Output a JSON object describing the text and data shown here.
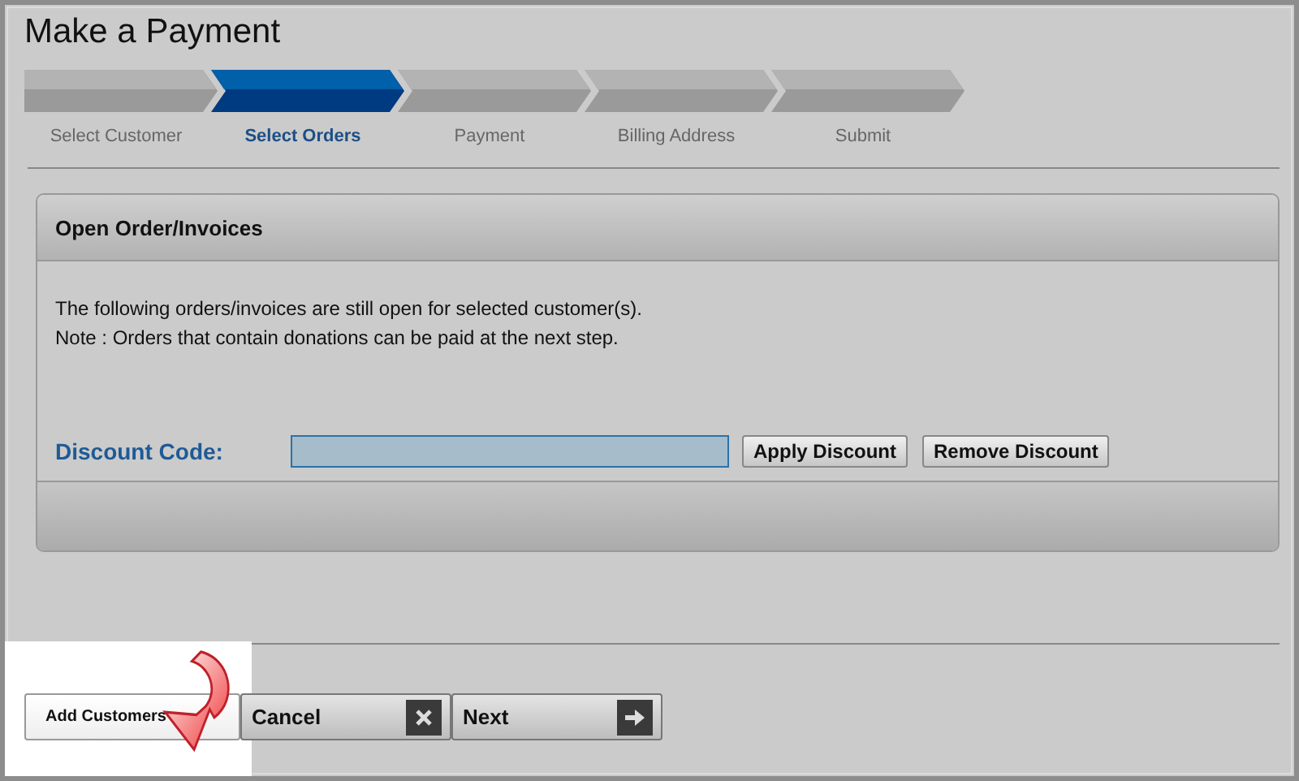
{
  "window": {
    "title": "Make a Payment"
  },
  "steps": [
    {
      "label": "Select Customer",
      "selected": false
    },
    {
      "label": "Select Orders",
      "selected": true
    },
    {
      "label": "Payment",
      "selected": false
    },
    {
      "label": "Billing Address",
      "selected": false
    },
    {
      "label": "Submit",
      "selected": false
    }
  ],
  "panel": {
    "title": "Open Order/Invoices",
    "lines": [
      "The following orders/invoices are still open for selected customer(s).",
      "Note : Orders that contain donations can be paid at the next step."
    ],
    "discount": {
      "label": "Discount Code:",
      "buttons": [
        "Apply Discount",
        "Remove Discount"
      ]
    }
  },
  "footer": {
    "add_button": "Add Customers",
    "highlighted": true,
    "cancel_button": "Cancel",
    "next_button": "Next"
  }
}
